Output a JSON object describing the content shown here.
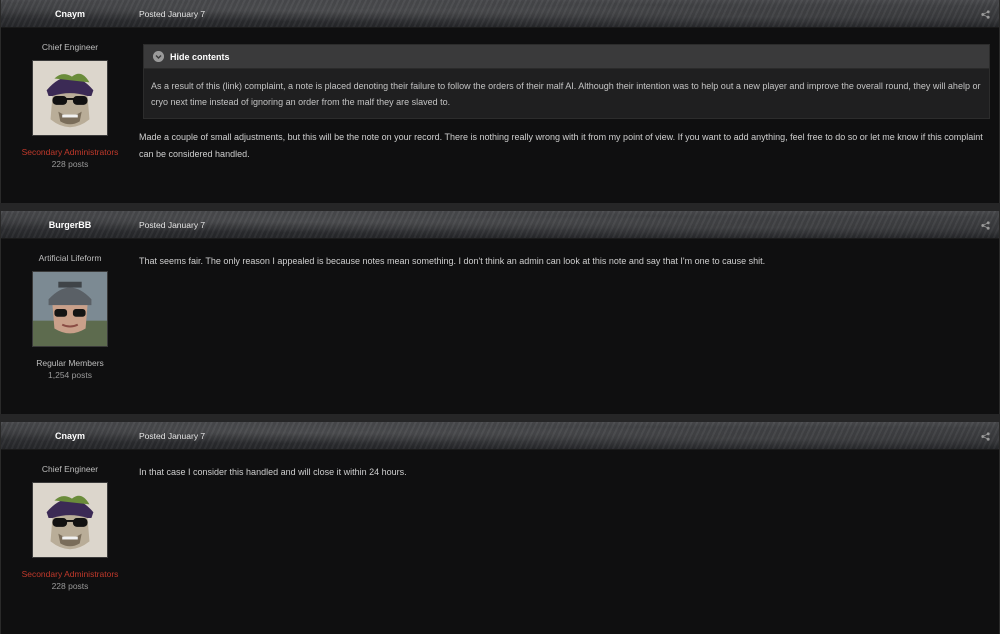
{
  "posts": [
    {
      "author": "Cnaym",
      "date": "Posted January 7",
      "title": "Chief Engineer",
      "group": "Secondary Administrators",
      "post_count": "228 posts",
      "spoiler": {
        "label": "Hide contents",
        "text": "As a result of this (link) complaint, a note is placed denoting their failure to follow the orders of their malf AI. Although their intention was to help out a new player and improve the overall round, they will ahelp or cryo next time instead of ignoring an order from the malf they are slaved to."
      },
      "body": "Made a couple of small adjustments, but this will be the note on your record. There is nothing really wrong with it from my point of view. If you want to add anything, feel free to do so or let me know if this complaint can be considered handled."
    },
    {
      "author": "BurgerBB",
      "date": "Posted January 7",
      "title": "Artificial Lifeform",
      "group": "Regular Members",
      "post_count": "1,254 posts",
      "body": "That seems fair. The only reason I appealed is because notes mean something. I don't think an admin can look at this note and say that I'm one to cause shit."
    },
    {
      "author": "Cnaym",
      "date": "Posted January 7",
      "title": "Chief Engineer",
      "group": "Secondary Administrators",
      "post_count": "228 posts",
      "body": "In that case I consider this handled and will close it within 24 hours."
    }
  ],
  "colors": {
    "admin_group": "#c0392b",
    "header_bg": "#3a3b3e",
    "post_bg": "#0f0f10"
  },
  "icons": {
    "share": "share-icon",
    "spoiler_toggle": "chevron-down-circle-icon"
  }
}
